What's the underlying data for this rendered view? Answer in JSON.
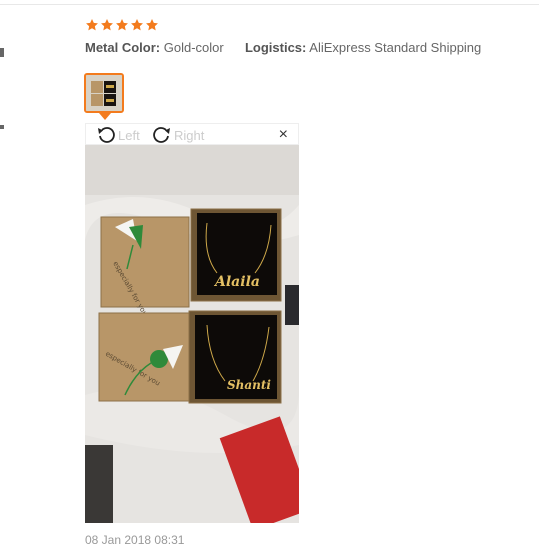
{
  "review": {
    "rating": 5,
    "metal_color_label": "Metal Color:",
    "metal_color_value": "Gold-color",
    "logistics_label": "Logistics:",
    "logistics_value": "AliExpress Standard Shipping",
    "date": "08 Jan 2018 08:31"
  },
  "viewer": {
    "rotate_left_label": "Left",
    "rotate_right_label": "Right",
    "close_label": "×",
    "box1_label": "especially for you",
    "box2_label": "especially for you",
    "necklace1_text": "Alaila",
    "necklace2_text": "Shanti"
  },
  "colors": {
    "accent": "#f37b1d",
    "star": "#f37b1d",
    "box_brown": "#b89668"
  }
}
